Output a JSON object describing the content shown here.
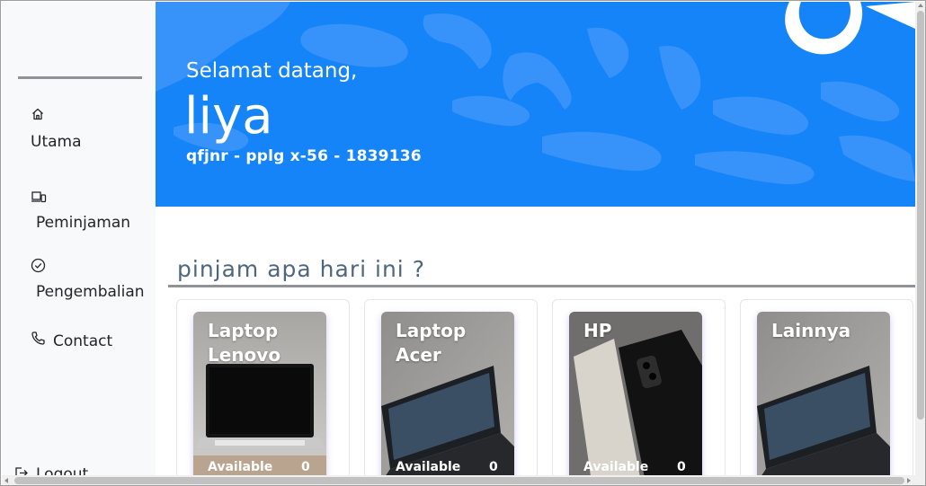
{
  "sidebar": {
    "items": [
      {
        "label": "Utama",
        "icon": "home-icon"
      },
      {
        "label": "Peminjaman",
        "icon": "devices-icon"
      },
      {
        "label": "Pengembalian",
        "icon": "check-circle-icon"
      },
      {
        "label": "Contact",
        "icon": "phone-icon"
      }
    ],
    "logout_label": "Logout"
  },
  "hero": {
    "greeting": "Selamat datang,",
    "name": "liya",
    "info": "qfjnr - pplg x-56 - 1839136",
    "background_color": "#1584f8"
  },
  "section": {
    "title": "pinjam apa hari ini ?"
  },
  "cards": [
    {
      "title": "Laptop Lenovo",
      "status": "Available",
      "count": "0"
    },
    {
      "title": "Laptop Acer",
      "status": "Available",
      "count": "0"
    },
    {
      "title": "HP",
      "status": "Available",
      "count": "0"
    },
    {
      "title": "Lainnya",
      "status": "",
      "count": ""
    }
  ]
}
